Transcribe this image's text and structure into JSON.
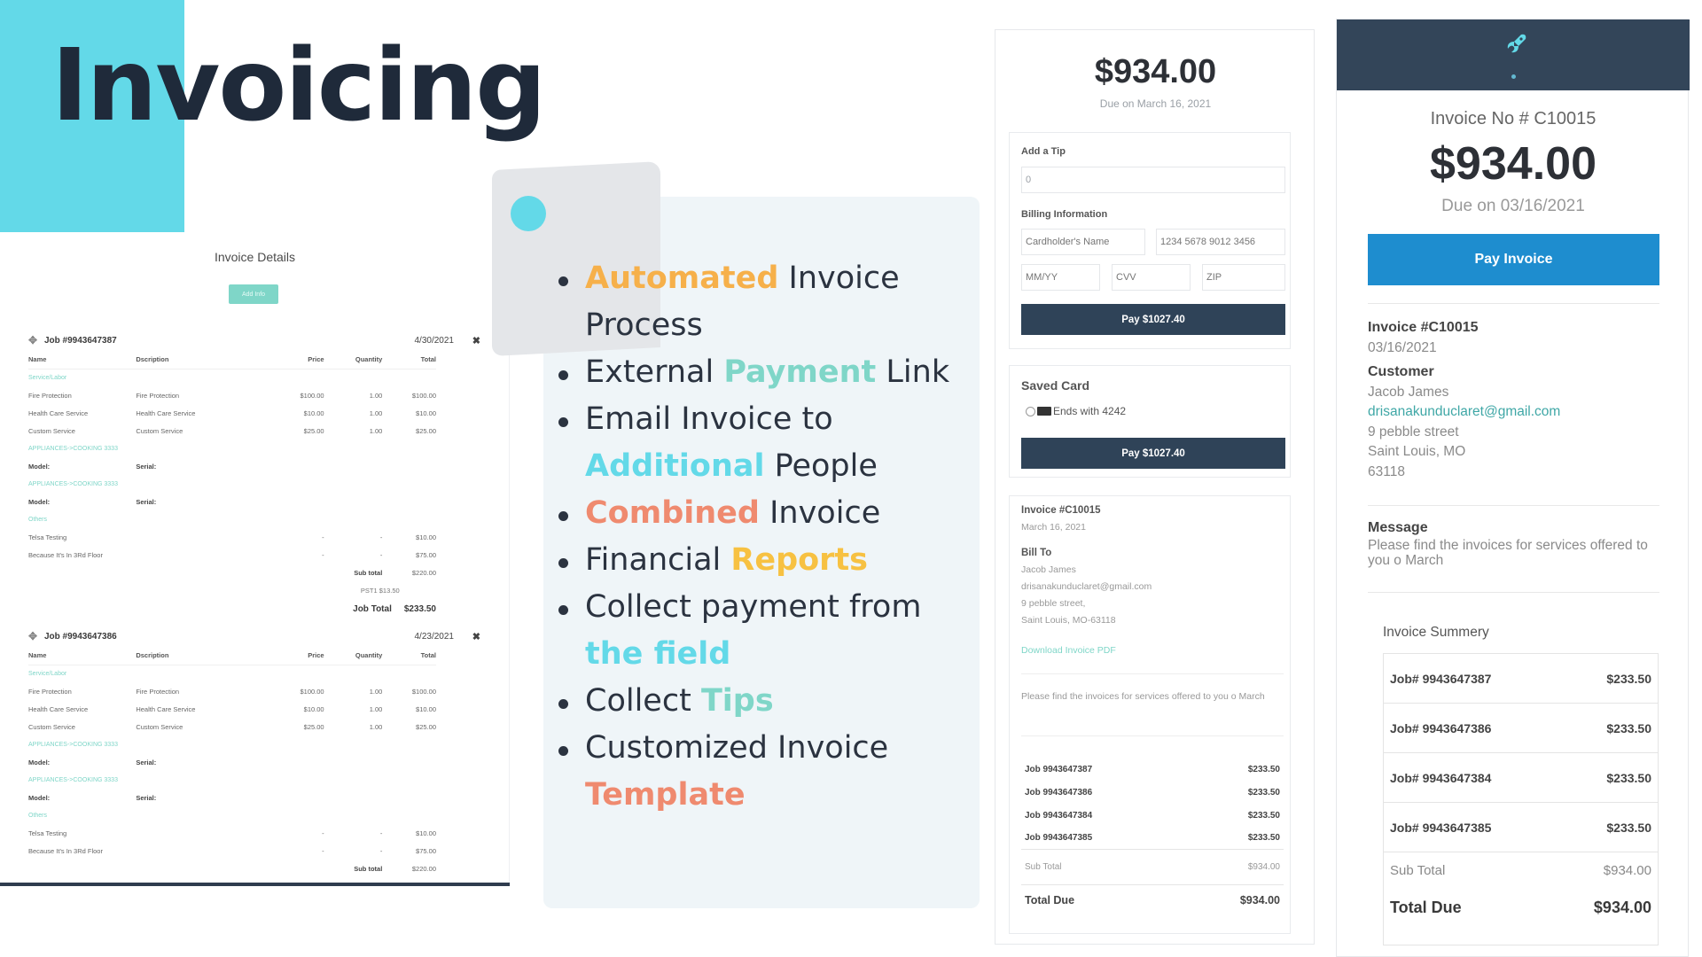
{
  "title": "Invoicing",
  "colors": {
    "accent_cyan": "#63d9e8",
    "dark": "#1f2a3a",
    "orange": "#f6b04a",
    "teal": "#7fd6c8",
    "coral": "#ef8a6f",
    "yellow": "#f7c142",
    "pay_blue": "#1e8dcf",
    "navy": "#2f4358"
  },
  "invoice_details": {
    "title": "Invoice Details",
    "add_info_button": "Add Info",
    "columns": [
      "Name",
      "Dscription",
      "Price",
      "Quantity",
      "Total"
    ],
    "jobs": [
      {
        "name": "Job #9943647387",
        "date": "4/30/2021",
        "category_services": "Service/Labor",
        "items": [
          {
            "name": "Fire Protection",
            "description": "Fire Protection",
            "price": "$100.00",
            "quantity": "1.00",
            "total": "$100.00"
          },
          {
            "name": "Health Care Service",
            "description": "Health Care Service",
            "price": "$10.00",
            "quantity": "1.00",
            "total": "$10.00"
          },
          {
            "name": "Custom Service",
            "description": "Custom Service",
            "price": "$25.00",
            "quantity": "1.00",
            "total": "$25.00"
          }
        ],
        "appliance_1": "APPLIANCES->COOKING 3333",
        "appliance_2": "APPLIANCES->COOKING 3333",
        "model_label": "Model:",
        "serial_label": "Serial:",
        "category_others": "Others",
        "others": [
          {
            "name": "Telsa Testing",
            "price": "-",
            "quantity": "-",
            "total": "$10.00"
          },
          {
            "name": "Because It's In 3Rd Floor",
            "price": "-",
            "quantity": "-",
            "total": "$75.00"
          }
        ],
        "subtotal_label": "Sub total",
        "subtotal": "$220.00",
        "tax": "PST1 $13.50",
        "job_total_label": "Job Total",
        "job_total": "$233.50"
      },
      {
        "name": "Job #9943647386",
        "date": "4/23/2021",
        "category_services": "Service/Labor",
        "items": [
          {
            "name": "Fire Protection",
            "description": "Fire Protection",
            "price": "$100.00",
            "quantity": "1.00",
            "total": "$100.00"
          },
          {
            "name": "Health Care Service",
            "description": "Health Care Service",
            "price": "$10.00",
            "quantity": "1.00",
            "total": "$10.00"
          },
          {
            "name": "Custom Service",
            "description": "Custom Service",
            "price": "$25.00",
            "quantity": "1.00",
            "total": "$25.00"
          }
        ],
        "appliance_1": "APPLIANCES->COOKING 3333",
        "appliance_2": "APPLIANCES->COOKING 3333",
        "model_label": "Model:",
        "serial_label": "Serial:",
        "category_others": "Others",
        "others": [
          {
            "name": "Telsa Testing",
            "price": "-",
            "quantity": "-",
            "total": "$10.00"
          },
          {
            "name": "Because It's In 3Rd Floor",
            "price": "-",
            "quantity": "-",
            "total": "$75.00"
          }
        ],
        "subtotal_label": "Sub total",
        "subtotal": "$220.00"
      }
    ]
  },
  "features": [
    {
      "parts": [
        {
          "text": "Automated",
          "color": "orange"
        },
        {
          "text": " Invoice Process"
        }
      ]
    },
    {
      "parts": [
        {
          "text": "External "
        },
        {
          "text": "Payment",
          "color": "teal"
        },
        {
          "text": " Link"
        }
      ]
    },
    {
      "parts": [
        {
          "text": "Email Invoice to "
        },
        {
          "text": "Additional",
          "color": "cyan"
        },
        {
          "text": " People"
        }
      ]
    },
    {
      "parts": [
        {
          "text": "Combined",
          "color": "coral"
        },
        {
          "text": " Invoice"
        }
      ]
    },
    {
      "parts": [
        {
          "text": "Financial "
        },
        {
          "text": "Reports",
          "color": "yellow"
        }
      ]
    },
    {
      "parts": [
        {
          "text": "Collect payment from "
        },
        {
          "text": "the field",
          "color": "cyan"
        }
      ]
    },
    {
      "parts": [
        {
          "text": "Collect "
        },
        {
          "text": "Tips",
          "color": "teal"
        }
      ]
    },
    {
      "parts": [
        {
          "text": "Customized Invoice "
        },
        {
          "text": "Template",
          "color": "coral"
        }
      ]
    }
  ],
  "payment_card": {
    "amount": "$934.00",
    "due": "Due on March 16, 2021",
    "tip_label": "Add a Tip",
    "tip_value": "0",
    "billing_label": "Billing Information",
    "cardholder_placeholder": "Cardholder's Name",
    "card_number_placeholder": "1234 5678 9012 3456",
    "expiry_placeholder": "MM/YY",
    "cvv_placeholder": "CVV",
    "zip_placeholder": "ZIP",
    "pay_button": "Pay $1027.40",
    "saved_card_label": "Saved Card",
    "saved_card_text": "Ends with 4242",
    "saved_pay_button": "Pay $1027.40",
    "invoice_no": "Invoice #C10015",
    "invoice_date": "March 16, 2021",
    "bill_to_label": "Bill To",
    "bill_to": [
      "Jacob James",
      "drisanakunduclaret@gmail.com",
      "9 pebble street,",
      "Saint Louis, MO-63118"
    ],
    "download_link": "Download Invoice PDF",
    "message": "Please find the invoices for services offered to you o March",
    "jobs": [
      {
        "name": "Job 9943647387",
        "amount": "$233.50"
      },
      {
        "name": "Job 9943647386",
        "amount": "$233.50"
      },
      {
        "name": "Job 9943647384",
        "amount": "$233.50"
      },
      {
        "name": "Job 9943647385",
        "amount": "$233.50"
      }
    ],
    "subtotal_label": "Sub Total",
    "subtotal": "$934.00",
    "total_label": "Total Due",
    "total": "$934.00"
  },
  "invoice_page": {
    "logo_icon": "rocket-icon",
    "invoice_no": "Invoice No # C10015",
    "amount": "$934.00",
    "due": "Due on 03/16/2021",
    "pay_button": "Pay Invoice",
    "invoice_label": "Invoice #C10015",
    "invoice_date": "03/16/2021",
    "customer_label": "Customer",
    "customer_name": "Jacob James",
    "customer_email": "drisanakunduclaret@gmail.com",
    "customer_street": "9 pebble street",
    "customer_city": "Saint Louis, MO",
    "customer_zip": "63118",
    "message_label": "Message",
    "message": "Please find the invoices for services offered to you o March",
    "summary_title": "Invoice Summery",
    "summary": [
      {
        "name": "Job# 9943647387",
        "amount": "$233.50"
      },
      {
        "name": "Job# 9943647386",
        "amount": "$233.50"
      },
      {
        "name": "Job# 9943647384",
        "amount": "$233.50"
      },
      {
        "name": "Job# 9943647385",
        "amount": "$233.50"
      }
    ],
    "subtotal_label": "Sub Total",
    "subtotal": "$934.00",
    "total_label": "Total Due",
    "total": "$934.00"
  }
}
